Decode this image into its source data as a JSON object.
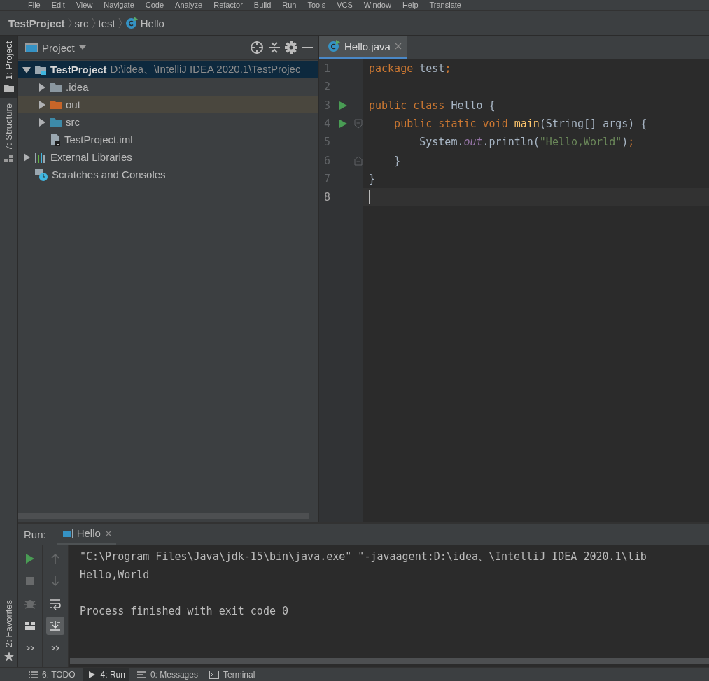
{
  "menu_bar": {
    "items": [
      "File",
      "Edit",
      "View",
      "Navigate",
      "Code",
      "Analyze",
      "Refactor",
      "Build",
      "Run",
      "Tools",
      "VCS",
      "Window",
      "Help",
      "Translate"
    ]
  },
  "breadcrumb": [
    {
      "label": "TestProject",
      "kind": "project"
    },
    {
      "label": "src",
      "kind": "folder"
    },
    {
      "label": "test",
      "kind": "folder"
    },
    {
      "label": "Hello",
      "kind": "class"
    }
  ],
  "left_strip": {
    "top": [
      {
        "label": "1: Project",
        "kind": "folder",
        "selected": true
      },
      {
        "label": "7: Structure",
        "kind": "structure",
        "selected": false
      }
    ],
    "bottom": [
      {
        "label": "2: Favorites",
        "kind": "star",
        "selected": false
      }
    ]
  },
  "project_panel": {
    "title": "Project",
    "tree": [
      {
        "label": "TestProject",
        "path": "D:\\idea、\\IntelliJ IDEA 2020.1\\TestProjec",
        "kind": "module",
        "expanded": true,
        "selected": true,
        "children": [
          {
            "label": ".idea",
            "kind": "folder",
            "expanded": false,
            "selected": false
          },
          {
            "label": "out",
            "kind": "excluded",
            "expanded": false,
            "selected": false
          },
          {
            "label": "src",
            "kind": "source",
            "expanded": false,
            "selected": false
          },
          {
            "label": "TestProject.iml",
            "kind": "file",
            "selected": false
          }
        ]
      },
      {
        "label": "External Libraries",
        "kind": "library",
        "expanded": false,
        "selected": false
      },
      {
        "label": "Scratches and Consoles",
        "kind": "scratches",
        "selected": false
      }
    ]
  },
  "editor": {
    "tabs": [
      {
        "label": "Hello.java",
        "selected": true
      }
    ],
    "lines": [
      {
        "number": "1",
        "tokens": [
          {
            "text": "package",
            "kind": "keyword"
          },
          {
            "text": " test",
            "kind": "plain"
          },
          {
            "text": ";",
            "kind": "keyword"
          }
        ]
      },
      {
        "number": "2"
      },
      {
        "number": "3",
        "run": true,
        "tokens": [
          {
            "text": "public class",
            "kind": "keyword"
          },
          {
            "text": " Hello {",
            "kind": "plain"
          }
        ]
      },
      {
        "number": "4",
        "run": true,
        "fold_start": true,
        "tokens": [
          {
            "text": "    public static void",
            "kind": "keyword"
          },
          {
            "text": " main",
            "kind": "method"
          },
          {
            "text": "(String[] args) {",
            "kind": "plain"
          }
        ]
      },
      {
        "number": "5",
        "tokens": [
          {
            "text": "        System.",
            "kind": "plain"
          },
          {
            "text": "out",
            "kind": "static"
          },
          {
            "text": ".println(",
            "kind": "plain"
          },
          {
            "text": "\"Hello,World\"",
            "kind": "string"
          },
          {
            "text": ")",
            "kind": "plain"
          },
          {
            "text": ";",
            "kind": "keyword"
          }
        ]
      },
      {
        "number": "6",
        "fold_end": true,
        "tokens": [
          {
            "text": "    }",
            "kind": "plain"
          }
        ]
      },
      {
        "number": "7",
        "tokens": [
          {
            "text": "}",
            "kind": "plain"
          }
        ]
      },
      {
        "number": "8",
        "current": true
      }
    ]
  },
  "run_panel": {
    "label": "Run:",
    "tabs": [
      {
        "label": "Hello",
        "selected": true
      }
    ],
    "toolbar_1": [
      {
        "kind": "rerun",
        "disabled": false
      },
      {
        "kind": "stop",
        "disabled": true
      },
      {
        "kind": "bug",
        "disabled": true
      },
      {
        "kind": "layout",
        "disabled": false
      },
      {
        "kind": "more",
        "disabled": false
      }
    ],
    "toolbar_2": [
      {
        "kind": "up",
        "disabled": true,
        "on": false
      },
      {
        "kind": "down",
        "disabled": true,
        "on": false
      },
      {
        "kind": "wrap",
        "disabled": false,
        "on": false
      },
      {
        "kind": "scroll-end",
        "disabled": false,
        "on": true
      },
      {
        "kind": "more",
        "disabled": false,
        "on": false
      }
    ],
    "output": [
      {
        "text": "\"C:\\Program Files\\Java\\jdk-15\\bin\\java.exe\" \"-javaagent:D:\\idea、\\IntelliJ IDEA 2020.1\\lib",
        "kind": "command"
      },
      {
        "text": "Hello,World",
        "kind": "stdout"
      },
      {
        "text": "Process finished with exit code 0",
        "kind": "exit"
      }
    ]
  },
  "bottom_bar": [
    {
      "label": "6: TODO",
      "kind": "list",
      "selected": false
    },
    {
      "label": "4: Run",
      "kind": "run",
      "selected": true
    },
    {
      "label": "0: Messages",
      "kind": "messages",
      "selected": false
    },
    {
      "label": "Terminal",
      "kind": "terminal",
      "selected": false
    }
  ]
}
